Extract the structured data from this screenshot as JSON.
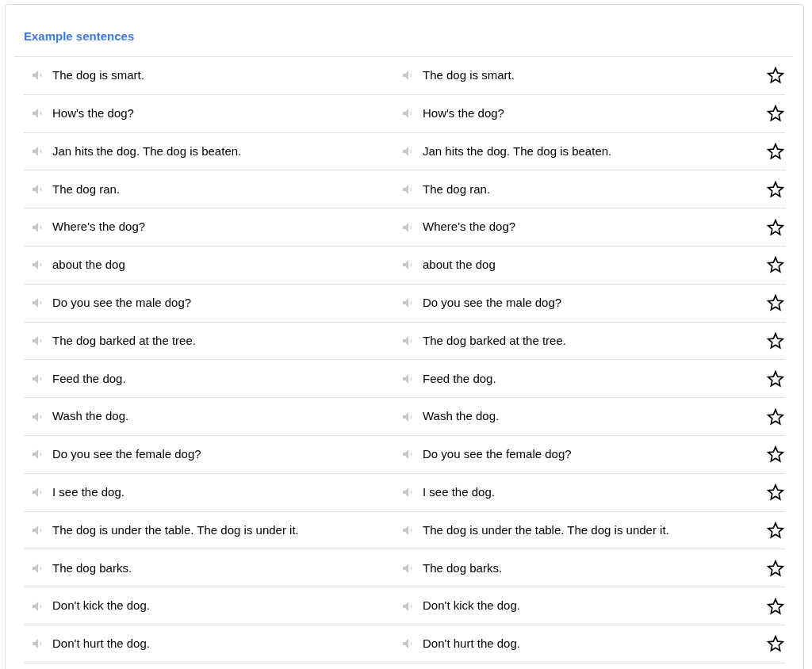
{
  "section": {
    "title": "Example sentences"
  },
  "rows": [
    {
      "source": "The dog is smart.",
      "translation": "The dog is smart.",
      "starred": false
    },
    {
      "source": "How's the dog?",
      "translation": "How's the dog?",
      "starred": false
    },
    {
      "source": "Jan hits the dog. The dog is beaten.",
      "translation": "Jan hits the dog. The dog is beaten.",
      "starred": false
    },
    {
      "source": "The dog ran.",
      "translation": "The dog ran.",
      "starred": false
    },
    {
      "source": "Where's the dog?",
      "translation": "Where's the dog?",
      "starred": false
    },
    {
      "source": "about the dog",
      "translation": "about the dog",
      "starred": false
    },
    {
      "source": "Do you see the male dog?",
      "translation": "Do you see the male dog?",
      "starred": false
    },
    {
      "source": "The dog barked at the tree.",
      "translation": "The dog barked at the tree.",
      "starred": false
    },
    {
      "source": "Feed the dog.",
      "translation": "Feed the dog.",
      "starred": false
    },
    {
      "source": "Wash the dog.",
      "translation": "Wash the dog.",
      "starred": false
    },
    {
      "source": "Do you see the female dog?",
      "translation": "Do you see the female dog?",
      "starred": false
    },
    {
      "source": "I see the dog.",
      "translation": "I see the dog.",
      "starred": false
    },
    {
      "source": "The dog is under the table. The dog is under it.",
      "translation": "The dog is under the table. The dog is under it.",
      "starred": false
    },
    {
      "source": "The dog barks.",
      "translation": "The dog barks.",
      "starred": false
    },
    {
      "source": "Don't kick the dog.",
      "translation": "Don't kick the dog.",
      "starred": false
    },
    {
      "source": "Don't hurt the dog.",
      "translation": "Don't hurt the dog.",
      "starred": false
    }
  ]
}
